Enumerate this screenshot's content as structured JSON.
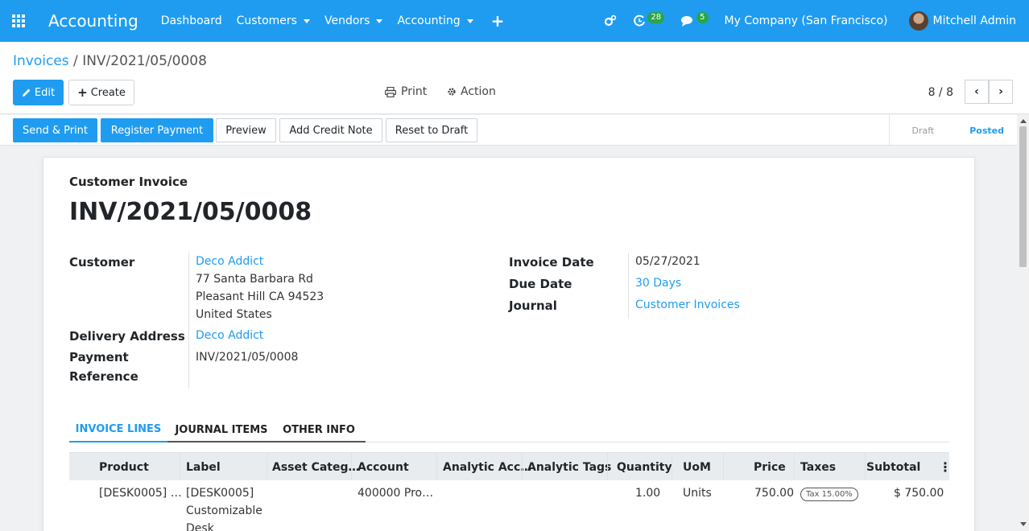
{
  "navbar": {
    "app_name": "Accounting",
    "menu": [
      "Dashboard",
      "Customers",
      "Vendors",
      "Accounting"
    ],
    "activity_count": "28",
    "message_count": "5",
    "company": "My Company (San Francisco)",
    "user": "Mitchell Admin"
  },
  "breadcrumb": {
    "parent": "Invoices",
    "separator": "/",
    "current": "INV/2021/05/0008"
  },
  "toolbar": {
    "edit_label": "Edit",
    "create_label": "Create",
    "print_label": "Print",
    "action_label": "Action",
    "pager": "8 / 8"
  },
  "statusbar": {
    "buttons": [
      "Send & Print",
      "Register Payment",
      "Preview",
      "Add Credit Note",
      "Reset to Draft"
    ],
    "stages": [
      "Draft",
      "Posted"
    ],
    "active_stage": "Posted"
  },
  "invoice": {
    "type": "Customer Invoice",
    "number": "INV/2021/05/0008",
    "customer_label": "Customer",
    "customer_name": "Deco Addict",
    "customer_address": [
      "77 Santa Barbara Rd",
      "Pleasant Hill CA 94523",
      "United States"
    ],
    "delivery_label": "Delivery Address",
    "delivery_name": "Deco Addict",
    "payment_ref_label_1": "Payment",
    "payment_ref_label_2": "Reference",
    "payment_ref": "INV/2021/05/0008",
    "invoice_date_label": "Invoice Date",
    "invoice_date": "05/27/2021",
    "due_date_label": "Due Date",
    "due_date": "30 Days",
    "journal_label": "Journal",
    "journal": "Customer Invoices"
  },
  "tabs": [
    "INVOICE LINES",
    "JOURNAL ITEMS",
    "OTHER INFO"
  ],
  "lines_table": {
    "columns": [
      "Product",
      "Label",
      "Asset Categ…",
      "Account",
      "Analytic Acc…",
      "Analytic Tags",
      "Quantity",
      "UoM",
      "Price",
      "Taxes",
      "Subtotal"
    ],
    "rows": [
      {
        "product": "[DESK0005] …",
        "label": [
          "[DESK0005]",
          "Customizable",
          "Desk"
        ],
        "asset_category": "",
        "account": "400000 Pro…",
        "analytic_account": "",
        "analytic_tags": "",
        "quantity": "1.00",
        "uom": "Units",
        "price": "750.00",
        "taxes": "Tax 15.00%",
        "subtotal": "$ 750.00"
      }
    ]
  }
}
